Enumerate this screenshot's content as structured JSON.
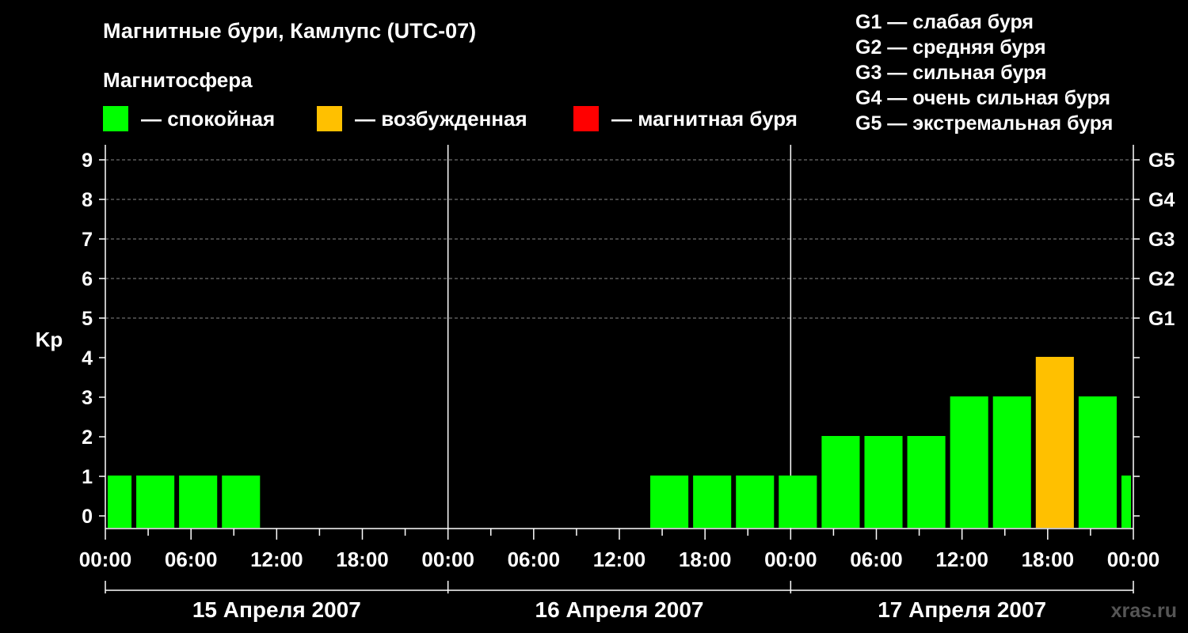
{
  "header": {
    "title": "Магнитные бури, Камлупс (UTC-07)",
    "subtitle": "Магнитосфера"
  },
  "legend": [
    {
      "color": "#00ff00",
      "label": "— спокойная"
    },
    {
      "color": "#ffc000",
      "label": "— возбужденная"
    },
    {
      "color": "#ff0000",
      "label": "— магнитная буря"
    }
  ],
  "g_scale": [
    "G1 — слабая буря",
    "G2 — средняя буря",
    "G3 — сильная буря",
    "G4 — очень сильная буря",
    "G5 — экстремальная буря"
  ],
  "watermark": "xras.ru",
  "chart_data": {
    "type": "bar",
    "ylabel": "Kp",
    "ylim": [
      0,
      9
    ],
    "y_ticks": [
      "0",
      "1",
      "2",
      "3",
      "4",
      "5",
      "6",
      "7",
      "8",
      "9"
    ],
    "right_axis": [
      {
        "kp": 5,
        "label": "G1"
      },
      {
        "kp": 6,
        "label": "G2"
      },
      {
        "kp": 7,
        "label": "G3"
      },
      {
        "kp": 8,
        "label": "G4"
      },
      {
        "kp": 9,
        "label": "G5"
      }
    ],
    "x_tick_labels": [
      "00:00",
      "06:00",
      "12:00",
      "18:00",
      "00:00",
      "06:00",
      "12:00",
      "18:00",
      "00:00",
      "06:00",
      "12:00",
      "18:00",
      "00:00"
    ],
    "days": [
      "15 Апреля 2007",
      "16 Апреля 2007",
      "17 Апреля 2007"
    ],
    "grid": true,
    "colors": {
      "quiet": "#00ff00",
      "active": "#ffc000",
      "storm": "#ff0000"
    },
    "bars": [
      {
        "start_hour": 0,
        "end_hour": 2,
        "kp": 1,
        "status": "quiet"
      },
      {
        "start_hour": 2,
        "end_hour": 5,
        "kp": 1,
        "status": "quiet"
      },
      {
        "start_hour": 5,
        "end_hour": 8,
        "kp": 1,
        "status": "quiet"
      },
      {
        "start_hour": 8,
        "end_hour": 11,
        "kp": 1,
        "status": "quiet"
      },
      {
        "start_hour": 38,
        "end_hour": 41,
        "kp": 1,
        "status": "quiet"
      },
      {
        "start_hour": 41,
        "end_hour": 44,
        "kp": 1,
        "status": "quiet"
      },
      {
        "start_hour": 44,
        "end_hour": 47,
        "kp": 1,
        "status": "quiet"
      },
      {
        "start_hour": 47,
        "end_hour": 50,
        "kp": 1,
        "status": "quiet"
      },
      {
        "start_hour": 50,
        "end_hour": 53,
        "kp": 2,
        "status": "quiet"
      },
      {
        "start_hour": 53,
        "end_hour": 56,
        "kp": 2,
        "status": "quiet"
      },
      {
        "start_hour": 56,
        "end_hour": 59,
        "kp": 2,
        "status": "quiet"
      },
      {
        "start_hour": 59,
        "end_hour": 62,
        "kp": 3,
        "status": "quiet"
      },
      {
        "start_hour": 62,
        "end_hour": 65,
        "kp": 3,
        "status": "quiet"
      },
      {
        "start_hour": 65,
        "end_hour": 68,
        "kp": 4,
        "status": "active"
      },
      {
        "start_hour": 68,
        "end_hour": 71,
        "kp": 3,
        "status": "quiet"
      },
      {
        "start_hour": 71,
        "end_hour": 72,
        "kp": 1,
        "status": "quiet"
      }
    ]
  }
}
